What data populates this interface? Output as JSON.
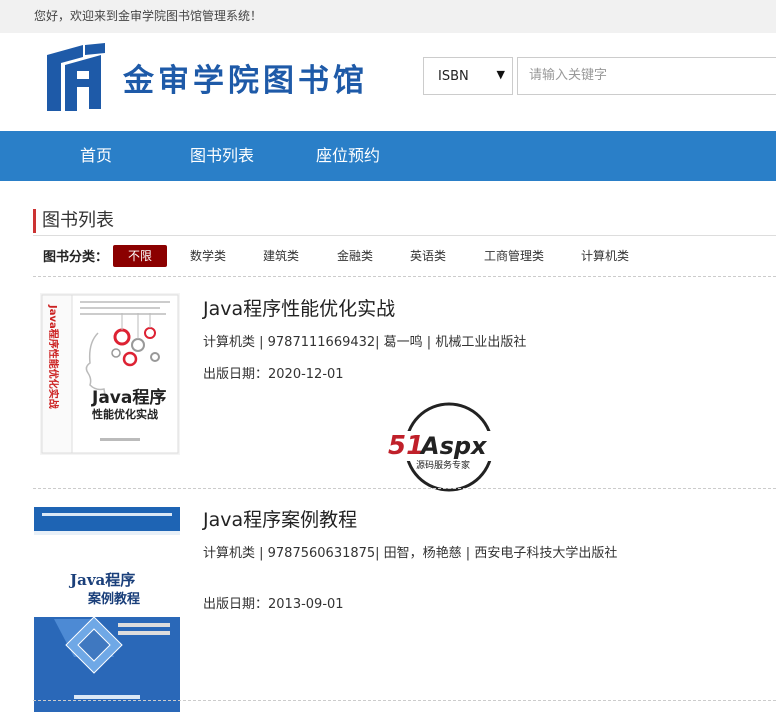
{
  "topbar": {
    "welcome": "您好，欢迎来到金审学院图书馆管理系统！"
  },
  "header": {
    "logo_text": "金审学院图书馆",
    "search": {
      "select_value": "ISBN",
      "placeholder": "请输入关键字"
    }
  },
  "nav": {
    "items": [
      "首页",
      "图书列表",
      "座位预约"
    ]
  },
  "section": {
    "title": "图书列表"
  },
  "categories": {
    "label": "图书分类：",
    "items": [
      "不限",
      "数学类",
      "建筑类",
      "金融类",
      "英语类",
      "工商管理类",
      "计算机类"
    ]
  },
  "books": [
    {
      "title": "Java程序性能优化实战",
      "meta": "计算机类 | 9787111669432| 葛一鸣 | 机械工业出版社",
      "date": "出版日期：2020-12-01",
      "cover": {
        "main_text": "Java程序",
        "sub_text": "性能优化实战",
        "spine_text": "Java程序性能优化实战"
      }
    },
    {
      "title": "Java程序案例教程",
      "meta": "计算机类 | 9787560631875| 田智，杨艳慈 | 西安电子科技大学出版社",
      "date": "出版日期：2013-09-01",
      "cover": {
        "main_text": "Java程序",
        "sub_text": "案例教程"
      }
    }
  ],
  "watermark": {
    "brand": "51Aspx",
    "tagline": "源码服务专家"
  },
  "colors": {
    "nav_bg": "#2a7fc8",
    "logo_blue": "#1e5aa8",
    "active_category": "#8b0000",
    "accent_red": "#cc3333"
  },
  "icons": {
    "select_arrow": "dropdown-arrow-icon"
  }
}
